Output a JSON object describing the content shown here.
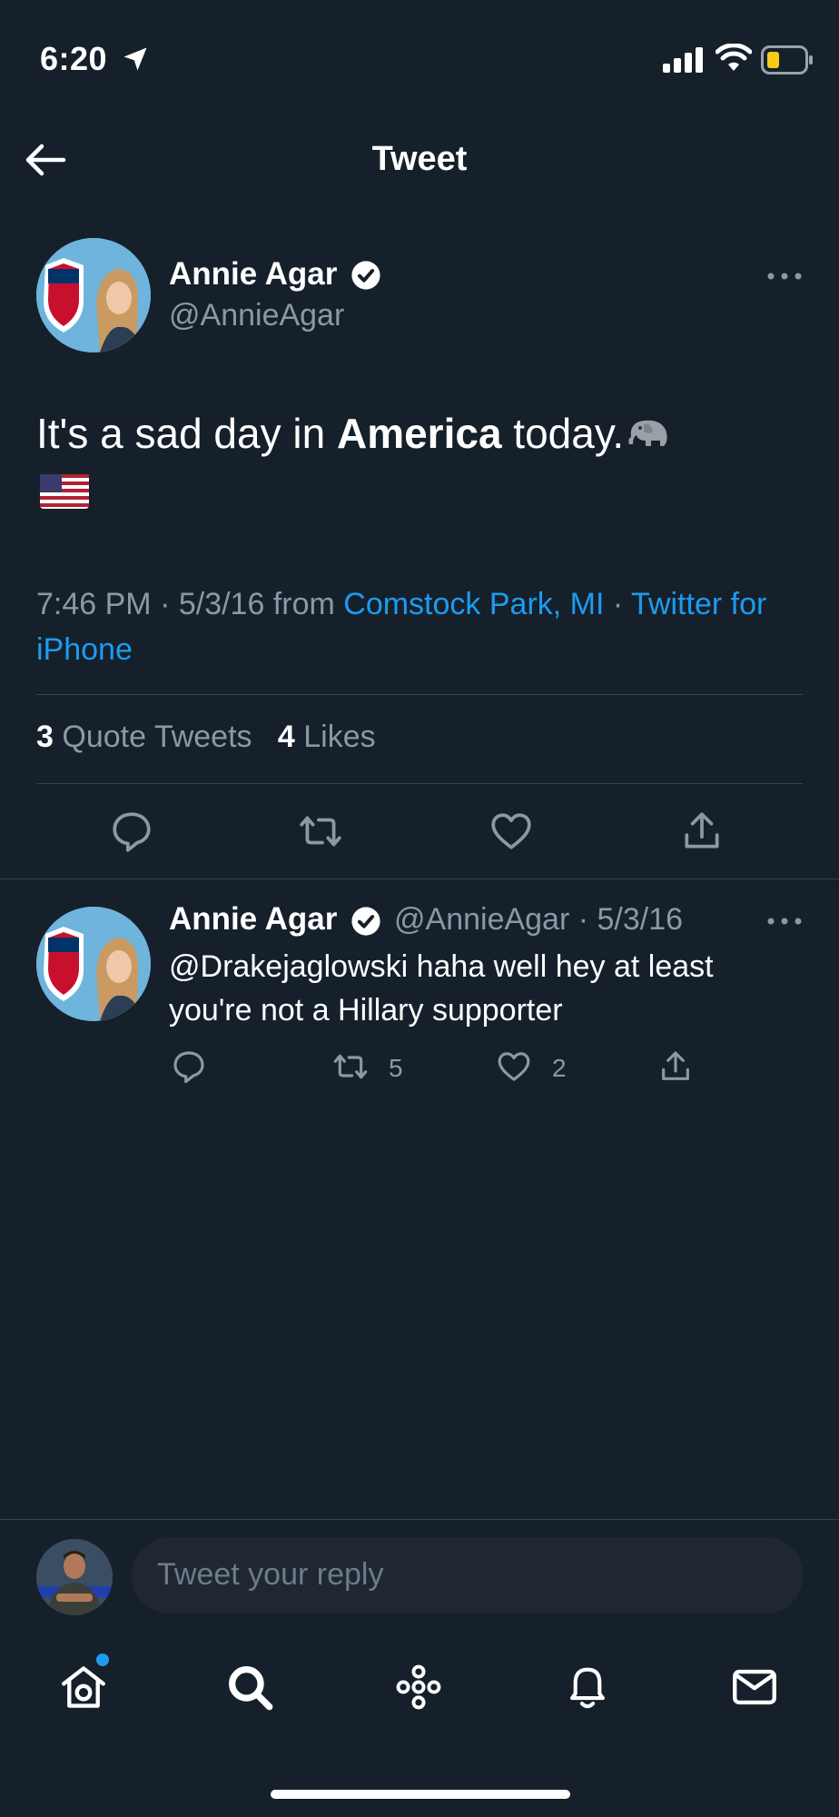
{
  "status_bar": {
    "time": "6:20"
  },
  "header": {
    "title": "Tweet"
  },
  "tweet": {
    "author_name": "Annie Agar",
    "author_handle": "@AnnieAgar",
    "text_part1": "It's a sad day in ",
    "text_bold": "America",
    "text_part2": " today.",
    "time": "7:46 PM · 5/3/16 from ",
    "location": "Comstock Park, MI",
    "separator": " · ",
    "source": "Twitter for iPhone",
    "stats": {
      "quote_count": "3",
      "quote_label": "Quote Tweets",
      "like_count": "4",
      "like_label": "Likes"
    }
  },
  "reply": {
    "author_name": "Annie Agar",
    "author_handle_date": "@AnnieAgar · 5/3/16",
    "text": "@Drakejaglowski haha well hey at least you're not a Hillary supporter",
    "retweet_count": "5",
    "like_count": "2"
  },
  "composer": {
    "placeholder": "Tweet your reply"
  },
  "colors": {
    "background": "#15202b",
    "accent": "#1d9bf0",
    "muted": "#8b98a5",
    "divider": "#38444d"
  },
  "icons": [
    "location-arrow-icon",
    "signal-icon",
    "wifi-icon",
    "battery-icon",
    "back-arrow-icon",
    "verified-icon",
    "more-icon",
    "elephant-emoji",
    "us-flag-emoji",
    "reply-icon",
    "retweet-icon",
    "like-icon",
    "share-icon",
    "home-icon",
    "search-icon",
    "spaces-icon",
    "notifications-icon",
    "messages-icon"
  ]
}
